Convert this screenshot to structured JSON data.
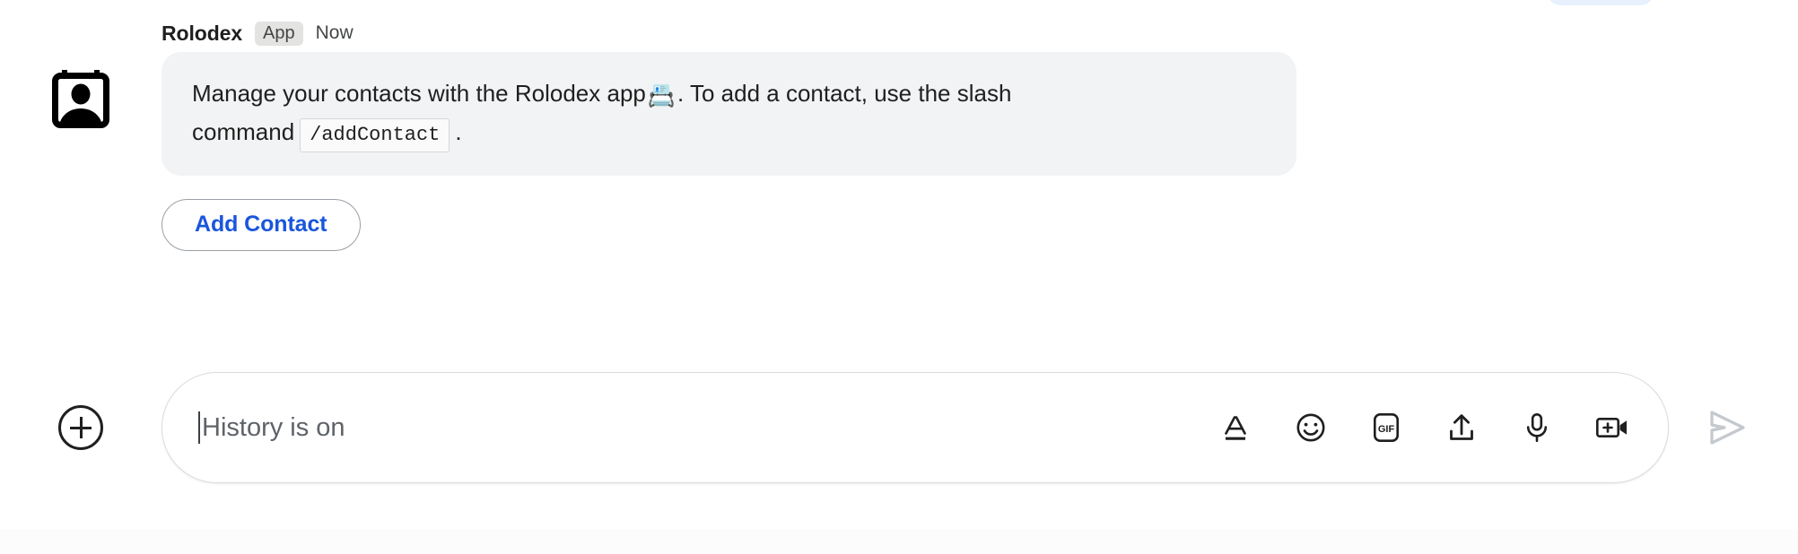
{
  "message": {
    "sender": "Rolodex",
    "badge": "App",
    "timestamp": "Now",
    "avatar_icon": "contact-card-icon",
    "text_part1": "Manage your contacts with the Rolodex app",
    "emoji": "📇",
    "text_part2": ". To add a contact, use the slash command",
    "code": "/addContact",
    "text_part3": "."
  },
  "actions": {
    "add_contact_label": "Add Contact"
  },
  "composer": {
    "plus_icon": "plus-circle-icon",
    "placeholder": "History is on",
    "value": "",
    "icons": [
      {
        "name": "format-text-icon",
        "label": "A"
      },
      {
        "name": "emoji-icon",
        "label": ""
      },
      {
        "name": "gif-icon",
        "label": "GIF"
      },
      {
        "name": "upload-file-icon",
        "label": ""
      },
      {
        "name": "microphone-icon",
        "label": ""
      },
      {
        "name": "add-video-icon",
        "label": ""
      }
    ],
    "send_icon": "send-arrow-icon"
  },
  "colors": {
    "accent_blue": "#1a56db",
    "bubble_bg": "#f1f3f4",
    "badge_bg": "#e3e3e1",
    "text_primary": "#1f1f1f",
    "text_secondary": "#444746",
    "placeholder": "#5f6368",
    "send_disabled": "#c4c9ce",
    "prev_bubble": "#e8f0fe"
  }
}
